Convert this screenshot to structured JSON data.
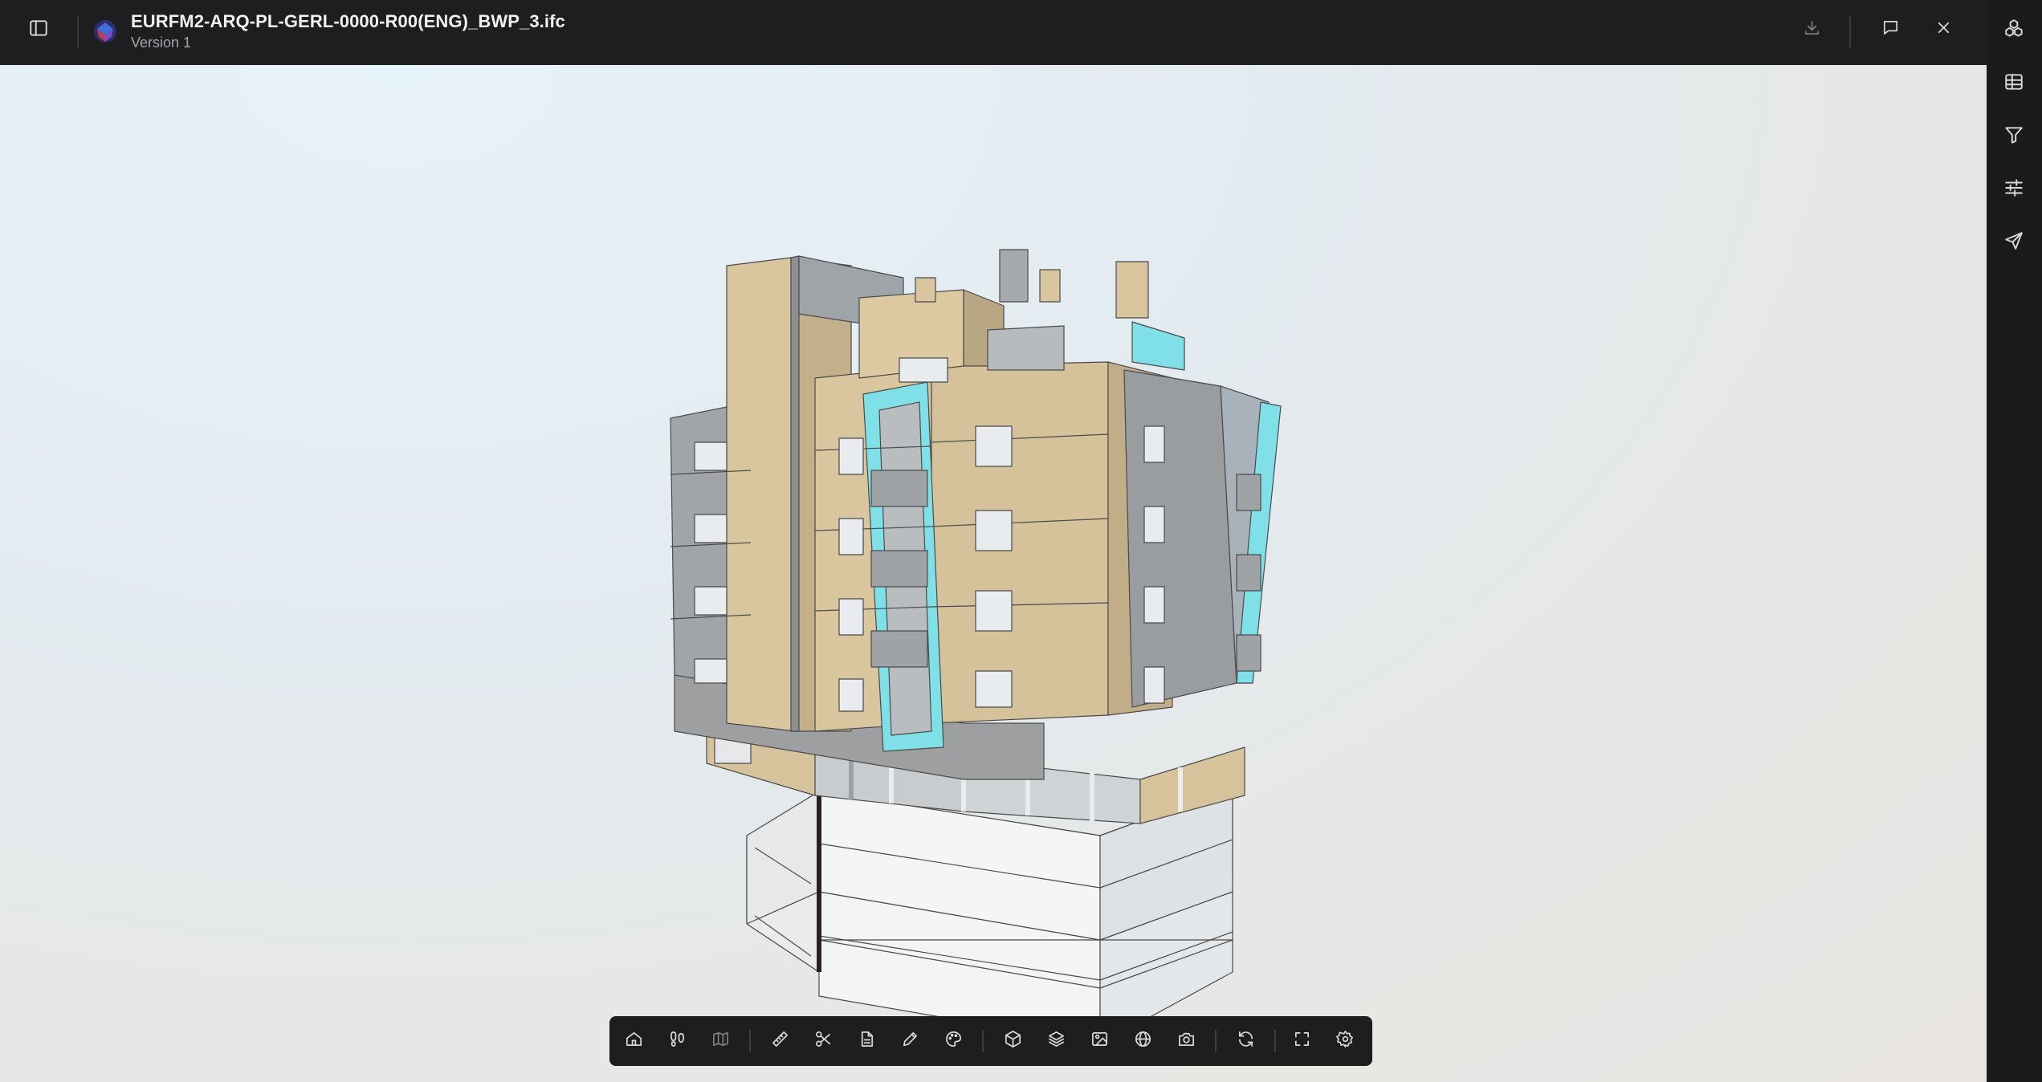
{
  "header": {
    "file_name": "EURFM2-ARQ-PL-GERL-0000-R00(ENG)_BWP_3.ifc",
    "version": "Version 1",
    "sidebar_toggle_icon": "sidebar-toggle-icon",
    "app_logo_icon": "app-logo-icon",
    "actions": [
      {
        "name": "download",
        "icon": "download-icon",
        "enabled": false
      },
      {
        "name": "comments",
        "icon": "comment-icon",
        "enabled": true
      },
      {
        "name": "close",
        "icon": "close-icon",
        "enabled": true
      }
    ]
  },
  "right_rail": {
    "items": [
      {
        "name": "models",
        "icon": "cubes-icon"
      },
      {
        "name": "table",
        "icon": "table-icon"
      },
      {
        "name": "filter",
        "icon": "filter-icon"
      },
      {
        "name": "properties",
        "icon": "sliders-icon"
      },
      {
        "name": "navigate",
        "icon": "send-icon"
      }
    ]
  },
  "viewer": {
    "content": "3D building model view",
    "colors": {
      "facade_beige": "#d8c49c",
      "facade_grey": "#a6a9ab",
      "glass_cyan": "#7fe0e8",
      "slab_white": "#f0f2f3",
      "background_top": "#e6f2f9",
      "background_bottom": "#e9e6e2"
    }
  },
  "toolbar": {
    "groups": [
      [
        "home-icon",
        "walk-icon",
        "map-icon"
      ],
      [
        "ruler-icon",
        "scissors-icon",
        "document-icon",
        "pencil-icon",
        "palette-icon"
      ],
      [
        "cube-icon",
        "layers-icon",
        "image-icon",
        "globe-icon",
        "camera-icon"
      ],
      [
        "refresh-icon"
      ],
      [
        "fullscreen-icon",
        "settings-icon"
      ]
    ]
  }
}
